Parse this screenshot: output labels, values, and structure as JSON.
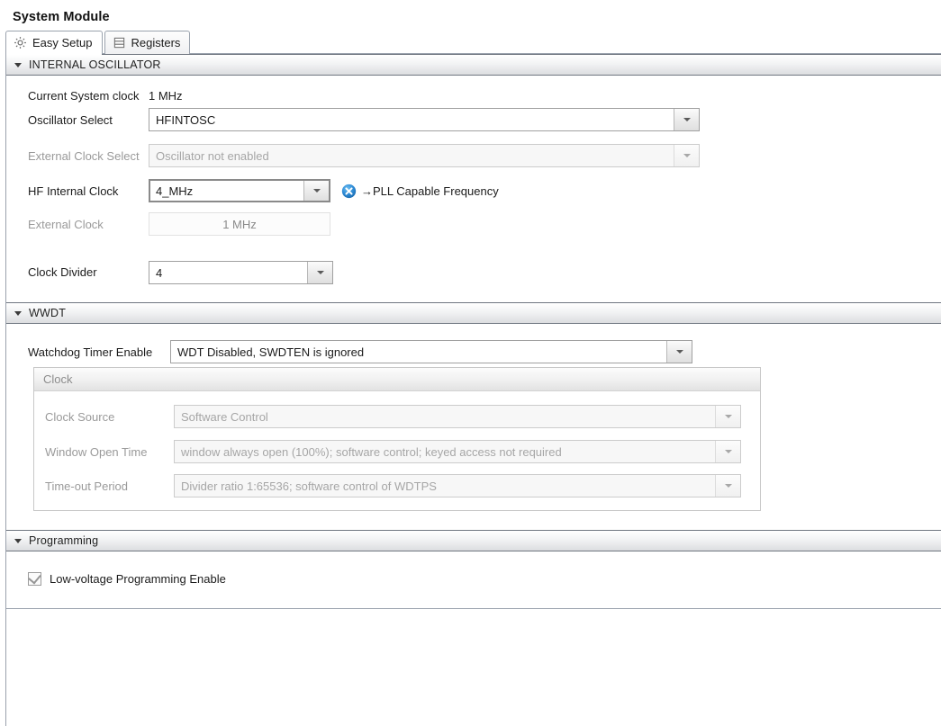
{
  "window": {
    "title": "System Module"
  },
  "tabs": [
    {
      "label": "Easy Setup",
      "icon": "gear-icon",
      "active": true
    },
    {
      "label": "Registers",
      "icon": "registers-icon",
      "active": false
    }
  ],
  "sections": {
    "internal_oscillator": {
      "title": "INTERNAL OSCILLATOR",
      "expanded": true,
      "fields": {
        "current_system_clock": {
          "label": "Current System clock",
          "value": "1 MHz"
        },
        "oscillator_select": {
          "label": "Oscillator Select",
          "value": "HFINTOSC",
          "enabled": true
        },
        "external_clock_select": {
          "label": "External Clock Select",
          "value": "Oscillator not enabled",
          "enabled": false
        },
        "hf_internal_clock": {
          "label": "HF Internal Clock",
          "value": "4_MHz",
          "enabled": true,
          "focused": true
        },
        "pll_note": {
          "icon": "pll-badge-icon",
          "text": "→PLL Capable Frequency"
        },
        "external_clock": {
          "label": "External Clock",
          "value": "1 MHz",
          "readonly": true
        },
        "clock_divider": {
          "label": "Clock Divider",
          "value": "4",
          "enabled": true
        }
      }
    },
    "wwdt": {
      "title": "WWDT",
      "expanded": true,
      "fields": {
        "watchdog_timer_enable": {
          "label": "Watchdog Timer Enable",
          "value": "WDT Disabled, SWDTEN is ignored",
          "enabled": true
        }
      },
      "clock_panel": {
        "title": "Clock",
        "fields": {
          "clock_source": {
            "label": "Clock Source",
            "value": "Software Control",
            "enabled": false
          },
          "window_open_time": {
            "label": "Window Open Time",
            "value": "window always open (100%); software control; keyed access not required",
            "enabled": false
          },
          "timeout_period": {
            "label": "Time-out Period",
            "value": "Divider ratio 1:65536; software control of WDTPS",
            "enabled": false
          }
        }
      }
    },
    "programming": {
      "title": "Programming",
      "expanded": true,
      "fields": {
        "low_voltage_programming": {
          "label": "Low-voltage Programming Enable",
          "checked": true,
          "enabled": false
        }
      }
    }
  },
  "colors": {
    "accent_blue": "#2E8BD6",
    "section_header_border": "#6F7680",
    "frame_border": "#9AA2AD",
    "disabled_text": "#A6A6A6"
  }
}
